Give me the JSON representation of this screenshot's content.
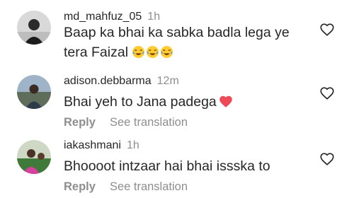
{
  "comments": [
    {
      "username": "md_mahfuz_05",
      "time": "1h",
      "text": "Baap ka bhai ka sabka badla lega ye tera Faizal",
      "emoji": [
        "face-with-tears-of-joy",
        "face-with-tears-of-joy",
        "face-with-tears-of-joy"
      ]
    },
    {
      "username": "adison.debbarma",
      "time": "12m",
      "text": "Bhai yeh to Jana padega",
      "emoji": [
        "red-heart"
      ],
      "reply_label": "Reply",
      "translation_label": "See translation"
    },
    {
      "username": "iakashmani",
      "time": "1h",
      "text": "Bhoooot intzaar hai bhai issska to",
      "reply_label": "Reply",
      "translation_label": "See translation"
    }
  ],
  "colors": {
    "primary_text": "#262626",
    "secondary_text": "#8e8e8e",
    "heart_red": "#ed4956"
  }
}
